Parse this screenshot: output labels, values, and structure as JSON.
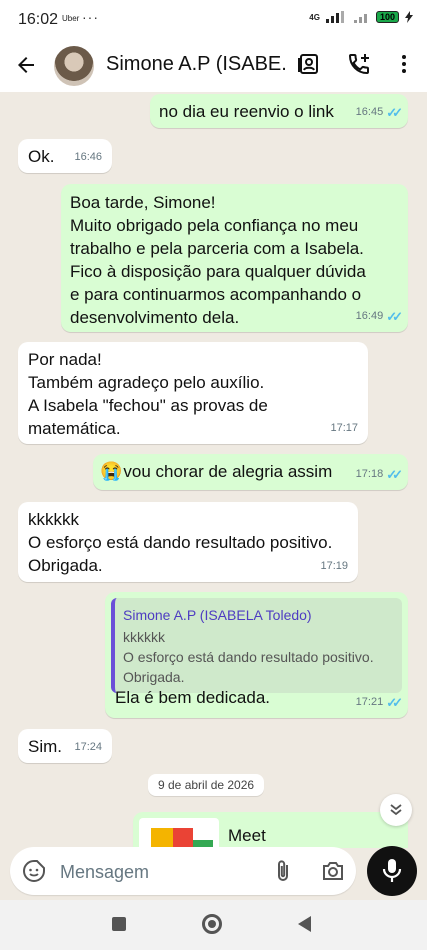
{
  "status_bar": {
    "time": "16:02",
    "app_label": "Uber",
    "more": "···",
    "network": "4G",
    "battery": "100"
  },
  "header": {
    "contact_name": "Simone A.P (ISABELA Toledo)",
    "title_display": "Simone A.P (ISABE..."
  },
  "messages": [
    {
      "dir": "out",
      "text": "no dia eu reenvio o link",
      "time": "16:45"
    },
    {
      "dir": "in",
      "text": "Ok.",
      "time": "16:46"
    },
    {
      "dir": "out",
      "lines": [
        "Boa tarde, Simone!",
        "Muito obrigado pela confiança no meu",
        "trabalho e pela parceria com a Isabela.",
        "Fico à disposição para qualquer dúvida",
        "e para continuarmos acompanhando o",
        "desenvolvimento dela."
      ],
      "time": "16:49"
    },
    {
      "dir": "in",
      "lines": [
        "Por nada!",
        "Também agradeço pelo auxílio.",
        "A Isabela \"fechou\" as provas de",
        "matemática."
      ],
      "time": "17:17"
    },
    {
      "dir": "out",
      "emoji": "😭",
      "text": "vou chorar de alegria assim",
      "time": "17:18"
    },
    {
      "dir": "in",
      "lines": [
        "kkkkkk",
        "O esforço está dando resultado positivo.",
        "Obrigada."
      ],
      "time": "17:19"
    },
    {
      "dir": "out",
      "quote": {
        "name": "Simone A.P (ISABELA Toledo)",
        "lines": [
          "kkkkkk",
          "O esforço está dando resultado positivo.",
          "Obrigada."
        ]
      },
      "text": "Ela é bem dedicada.",
      "time": "17:21"
    },
    {
      "dir": "in",
      "text": "Sim.",
      "time": "17:24"
    }
  ],
  "date_chip": "9 de abril de 2026",
  "preview": {
    "title": "Meet"
  },
  "composer": {
    "placeholder": "Mensagem"
  }
}
